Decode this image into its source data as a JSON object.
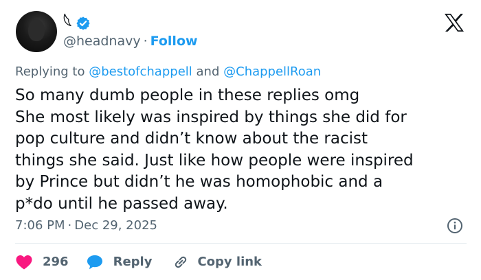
{
  "author": {
    "display_name": "𓆩",
    "handle": "@headnavy",
    "separator": "·",
    "follow_label": "Follow"
  },
  "reply_context": {
    "prefix": "Replying to",
    "mention_1": "@bestofchappell",
    "conjunction": "and",
    "mention_2": "@ChappellRoan"
  },
  "tweet": {
    "lines": [
      "So many dumb people in these replies omg",
      "She most likely was inspired by things she did for",
      "pop culture and didn’t know about the racist",
      "things she said. Just like how people were inspired",
      "by Prince but didn’t he was homophobic and a",
      "p*do until he passed away."
    ],
    "time": "7:06 PM",
    "separator": "·",
    "date": "Dec 29, 2025"
  },
  "actions": {
    "like_count": "296",
    "reply_label": "Reply",
    "copy_link_label": "Copy link"
  },
  "icons": {
    "verified": "verified-badge-icon",
    "logo": "x-logo-icon",
    "info": "info-icon",
    "like": "heart-icon",
    "reply": "speech-bubble-icon",
    "copy": "link-icon"
  },
  "colors": {
    "accent": "#1d9bf0",
    "like": "#f91880",
    "secondary_text": "#536471",
    "primary_text": "#0f1419",
    "divider": "#e6ecf0"
  }
}
